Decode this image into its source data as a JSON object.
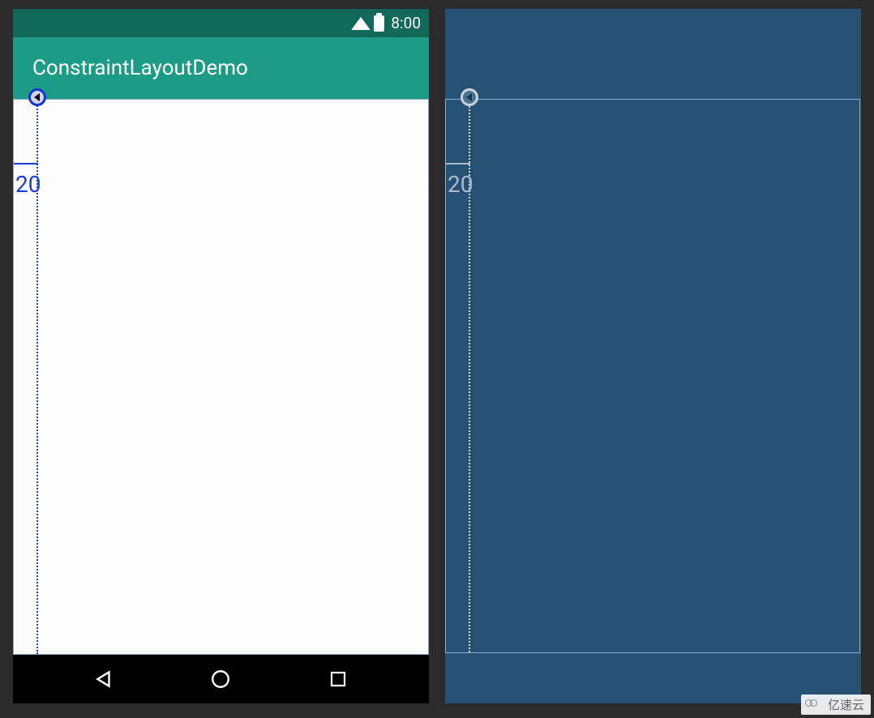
{
  "status_bar": {
    "time": "8:00"
  },
  "app_bar": {
    "title": "ConstraintLayoutDemo"
  },
  "design": {
    "guideline_value": "20"
  },
  "blueprint": {
    "guideline_value": "20"
  },
  "watermark": {
    "text": "亿速云"
  }
}
